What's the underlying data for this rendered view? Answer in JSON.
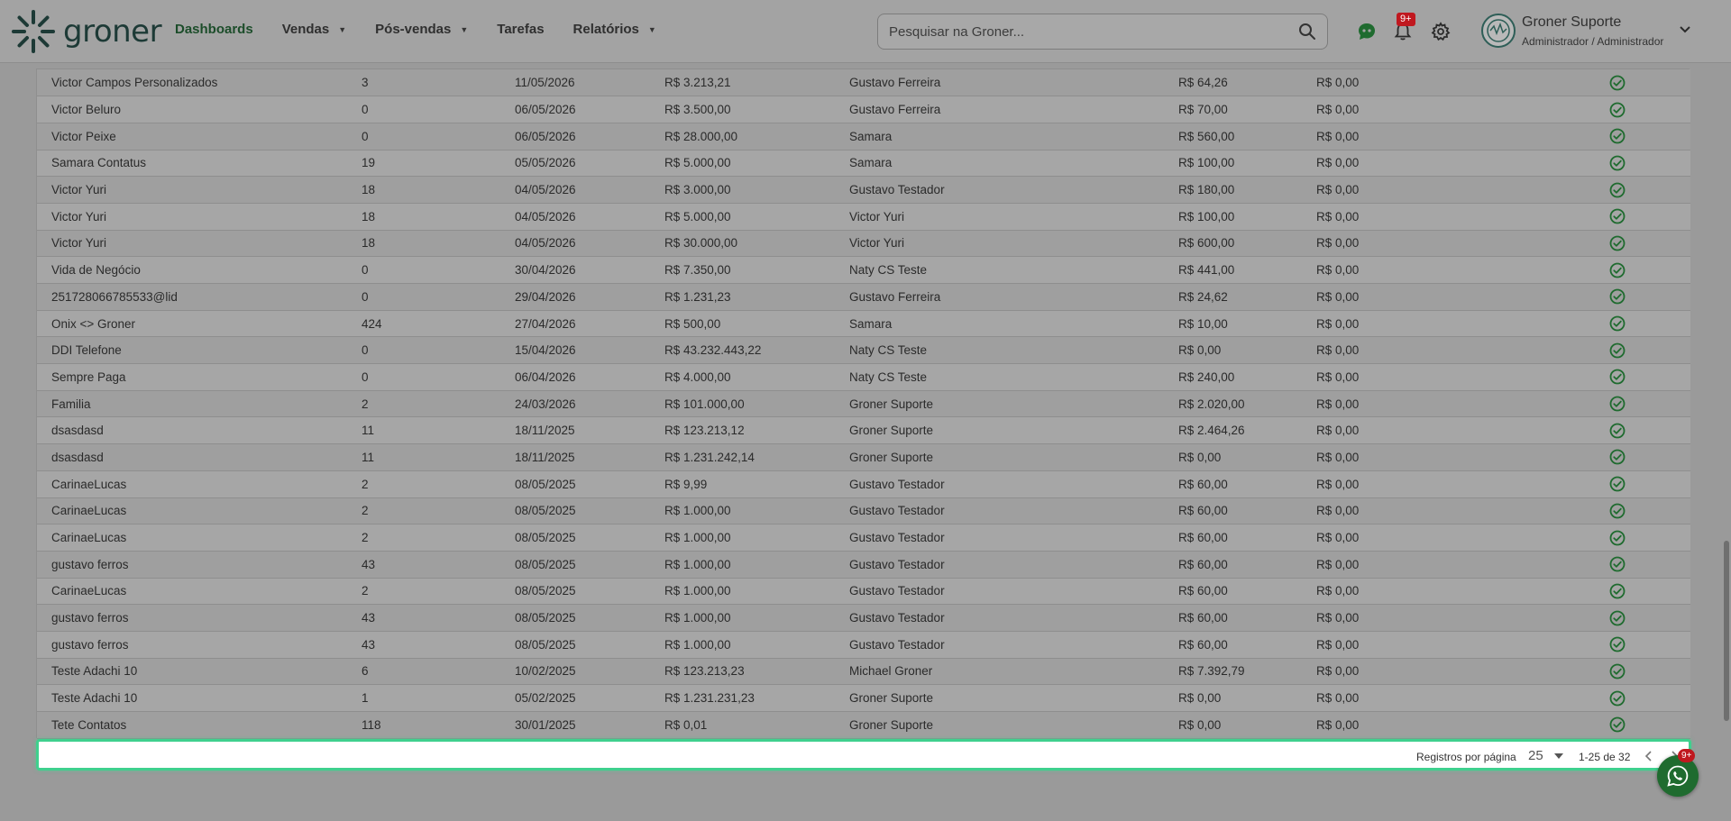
{
  "brand": {
    "name": "groner"
  },
  "nav": [
    {
      "label": "Dashboards",
      "active": true,
      "caret": false
    },
    {
      "label": "Vendas",
      "active": false,
      "caret": true
    },
    {
      "label": "Pós-vendas",
      "active": false,
      "caret": true
    },
    {
      "label": "Tarefas",
      "active": false,
      "caret": false
    },
    {
      "label": "Relatórios",
      "active": false,
      "caret": true
    }
  ],
  "search": {
    "placeholder": "Pesquisar na Groner..."
  },
  "notifications": {
    "badge": "9+"
  },
  "user": {
    "name": "Groner Suporte",
    "role": "Administrador / Administrador"
  },
  "rows": [
    [
      "Victor Campos Personalizados",
      "3",
      "11/05/2026",
      "R$ 3.213,21",
      "Gustavo Ferreira",
      "R$ 64,26",
      "R$ 0,00"
    ],
    [
      "Victor Beluro",
      "0",
      "06/05/2026",
      "R$ 3.500,00",
      "Gustavo Ferreira",
      "R$ 70,00",
      "R$ 0,00"
    ],
    [
      "Victor Peixe",
      "0",
      "06/05/2026",
      "R$ 28.000,00",
      "Samara",
      "R$ 560,00",
      "R$ 0,00"
    ],
    [
      "Samara Contatus",
      "19",
      "05/05/2026",
      "R$ 5.000,00",
      "Samara",
      "R$ 100,00",
      "R$ 0,00"
    ],
    [
      "Victor Yuri",
      "18",
      "04/05/2026",
      "R$ 3.000,00",
      "Gustavo Testador",
      "R$ 180,00",
      "R$ 0,00"
    ],
    [
      "Victor Yuri",
      "18",
      "04/05/2026",
      "R$ 5.000,00",
      "Victor Yuri",
      "R$ 100,00",
      "R$ 0,00"
    ],
    [
      "Victor Yuri",
      "18",
      "04/05/2026",
      "R$ 30.000,00",
      "Victor Yuri",
      "R$ 600,00",
      "R$ 0,00"
    ],
    [
      "Vida de Negócio",
      "0",
      "30/04/2026",
      "R$ 7.350,00",
      "Naty CS Teste",
      "R$ 441,00",
      "R$ 0,00"
    ],
    [
      "251728066785533@lid",
      "0",
      "29/04/2026",
      "R$ 1.231,23",
      "Gustavo Ferreira",
      "R$ 24,62",
      "R$ 0,00"
    ],
    [
      "Onix <> Groner",
      "424",
      "27/04/2026",
      "R$ 500,00",
      "Samara",
      "R$ 10,00",
      "R$ 0,00"
    ],
    [
      "DDI Telefone",
      "0",
      "15/04/2026",
      "R$ 43.232.443,22",
      "Naty CS Teste",
      "R$ 0,00",
      "R$ 0,00"
    ],
    [
      "Sempre Paga",
      "0",
      "06/04/2026",
      "R$ 4.000,00",
      "Naty CS Teste",
      "R$ 240,00",
      "R$ 0,00"
    ],
    [
      "Familia",
      "2",
      "24/03/2026",
      "R$ 101.000,00",
      "Groner Suporte",
      "R$ 2.020,00",
      "R$ 0,00"
    ],
    [
      "dsasdasd",
      "11",
      "18/11/2025",
      "R$ 123.213,12",
      "Groner Suporte",
      "R$ 2.464,26",
      "R$ 0,00"
    ],
    [
      "dsasdasd",
      "11",
      "18/11/2025",
      "R$ 1.231.242,14",
      "Groner Suporte",
      "R$ 0,00",
      "R$ 0,00"
    ],
    [
      "CarinaeLucas",
      "2",
      "08/05/2025",
      "R$ 9,99",
      "Gustavo Testador",
      "R$ 60,00",
      "R$ 0,00"
    ],
    [
      "CarinaeLucas",
      "2",
      "08/05/2025",
      "R$ 1.000,00",
      "Gustavo Testador",
      "R$ 60,00",
      "R$ 0,00"
    ],
    [
      "CarinaeLucas",
      "2",
      "08/05/2025",
      "R$ 1.000,00",
      "Gustavo Testador",
      "R$ 60,00",
      "R$ 0,00"
    ],
    [
      "gustavo ferros",
      "43",
      "08/05/2025",
      "R$ 1.000,00",
      "Gustavo Testador",
      "R$ 60,00",
      "R$ 0,00"
    ],
    [
      "CarinaeLucas",
      "2",
      "08/05/2025",
      "R$ 1.000,00",
      "Gustavo Testador",
      "R$ 60,00",
      "R$ 0,00"
    ],
    [
      "gustavo ferros",
      "43",
      "08/05/2025",
      "R$ 1.000,00",
      "Gustavo Testador",
      "R$ 60,00",
      "R$ 0,00"
    ],
    [
      "gustavo ferros",
      "43",
      "08/05/2025",
      "R$ 1.000,00",
      "Gustavo Testador",
      "R$ 60,00",
      "R$ 0,00"
    ],
    [
      "Teste Adachi 10",
      "6",
      "10/02/2025",
      "R$ 123.213,23",
      "Michael Groner",
      "R$ 7.392,79",
      "R$ 0,00"
    ],
    [
      "Teste Adachi 10",
      "1",
      "05/02/2025",
      "R$ 1.231.231,23",
      "Groner Suporte",
      "R$ 0,00",
      "R$ 0,00"
    ],
    [
      "Tete Contatos",
      "118",
      "30/01/2025",
      "R$ 0,01",
      "Groner Suporte",
      "R$ 0,00",
      "R$ 0,00"
    ]
  ],
  "pagination": {
    "label": "Registros por página",
    "page_size": "25",
    "range": "1-25 de 32"
  },
  "whatsapp": {
    "badge": "9+"
  },
  "colors": {
    "brand": "#1d3a36",
    "status_ok": "#1f6b2f",
    "accent_border": "#3fd08e",
    "badge": "#c0181f"
  },
  "icons": {
    "logo": "sunburst-logo-icon",
    "search": "search-icon",
    "chat": "chat-bot-icon",
    "notifications": "bell-icon",
    "settings": "gear-icon",
    "status": "check-circle-icon",
    "fab": "whatsapp-icon"
  }
}
